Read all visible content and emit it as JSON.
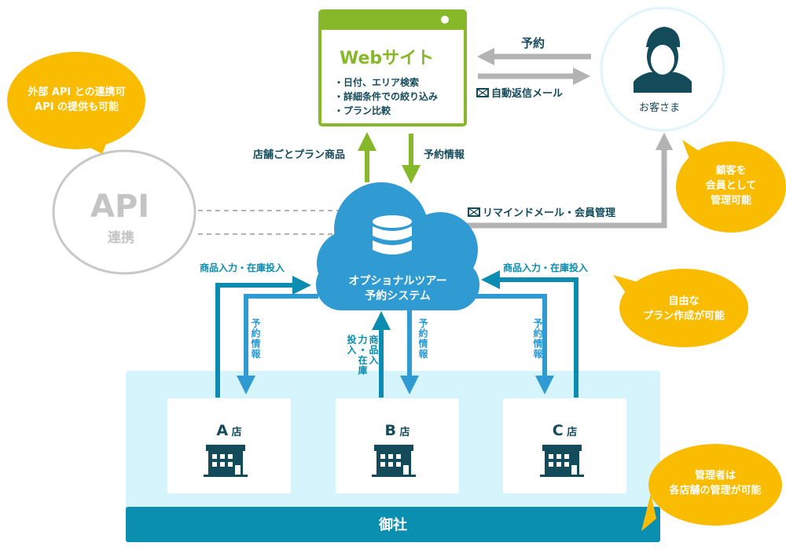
{
  "website": {
    "title": "Webサイト",
    "features": [
      "・日付、エリア検索",
      "・詳細条件での絞り込み",
      "・プラン比較"
    ]
  },
  "customer": {
    "label": "お客さま"
  },
  "flows": {
    "reservation": "予約",
    "auto_reply": "自動返信メール",
    "store_plans": "店舗ごとプラン商品",
    "reservation_info": "予約情報",
    "remind": "リマインドメール・会員管理",
    "product_input": "商品入力・在庫投入",
    "reservation_info_vertical": "予約情報",
    "product_input_vertical": "商品入力・在庫投入"
  },
  "api": {
    "title": "API",
    "subtitle": "連携"
  },
  "system": {
    "line1": "オプショナルツアー",
    "line2": "予約システム"
  },
  "stores": [
    {
      "letter": "A",
      "suffix": "店"
    },
    {
      "letter": "B",
      "suffix": "店"
    },
    {
      "letter": "C",
      "suffix": "店"
    }
  ],
  "company": {
    "label": "御社"
  },
  "bubbles": {
    "api": [
      "外部 API との連携可",
      "API の提供も可能"
    ],
    "members": [
      "顧客を",
      "会員として",
      "管理可能"
    ],
    "plans": [
      "自由な",
      "プラン作成が可能"
    ],
    "admin": [
      "管理者は",
      "各店舗の管理が可能"
    ]
  },
  "colors": {
    "green": "#86b829",
    "cloud": "#2f9bd2",
    "teal_dark": "#0b8cb0",
    "gray": "#b3b3b3",
    "yellow": "#f9bc00",
    "light_bg": "#d6f4fc",
    "text_dark": "#134b5b"
  }
}
